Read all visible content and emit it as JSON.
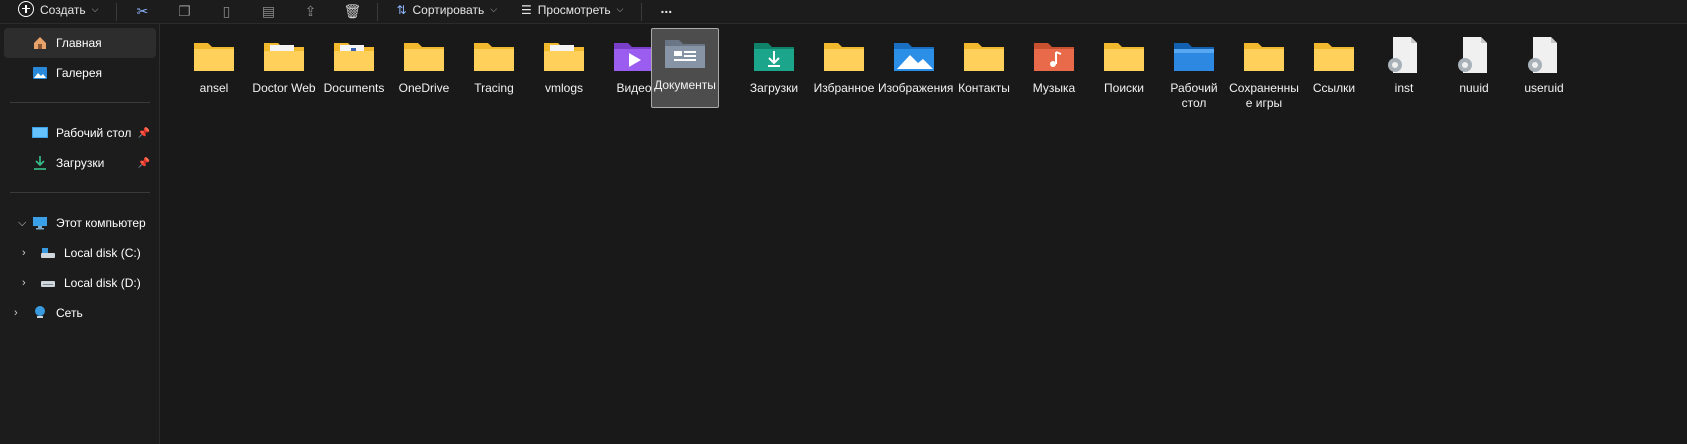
{
  "toolbar": {
    "create_label": "Создать",
    "sort_label": "Сортировать",
    "view_label": "Просмотреть",
    "more_label": "..."
  },
  "sidebar": {
    "items": [
      {
        "label": "Главная",
        "icon": "home-icon"
      },
      {
        "label": "Галерея",
        "icon": "gallery-icon"
      },
      {
        "label": "Рабочий стол",
        "icon": "desktop-icon",
        "pinned": true
      },
      {
        "label": "Загрузки",
        "icon": "downloads-icon",
        "pinned": true
      },
      {
        "label": "Этот компьютер",
        "icon": "computer-icon"
      },
      {
        "label": "Local disk (C:)",
        "icon": "disk-c-icon"
      },
      {
        "label": "Local disk (D:)",
        "icon": "disk-d-icon"
      },
      {
        "label": "Сеть",
        "icon": "network-icon"
      }
    ]
  },
  "items": [
    {
      "label": "ansel",
      "type": "folder"
    },
    {
      "label": "Doctor Web",
      "type": "folder-files"
    },
    {
      "label": "Documents",
      "type": "folder-files"
    },
    {
      "label": "OneDrive",
      "type": "folder"
    },
    {
      "label": "Tracing",
      "type": "folder"
    },
    {
      "label": "vmlogs",
      "type": "folder-files"
    },
    {
      "label": "Видео",
      "type": "video-folder"
    },
    {
      "label": "Документы",
      "type": "docs-folder",
      "selected": true
    },
    {
      "label": "Загрузки",
      "type": "downloads-folder"
    },
    {
      "label": "Избранное",
      "type": "folder"
    },
    {
      "label": "Изображения",
      "type": "pictures-folder"
    },
    {
      "label": "Контакты",
      "type": "folder"
    },
    {
      "label": "Музыка",
      "type": "music-folder"
    },
    {
      "label": "Поиски",
      "type": "folder"
    },
    {
      "label": "Рабочий стол",
      "type": "desktop-folder"
    },
    {
      "label": "Сохраненные игры",
      "type": "folder"
    },
    {
      "label": "Ссылки",
      "type": "folder"
    },
    {
      "label": "inst",
      "type": "settings-file"
    },
    {
      "label": "nuuid",
      "type": "settings-file"
    },
    {
      "label": "useruid",
      "type": "settings-file"
    }
  ]
}
